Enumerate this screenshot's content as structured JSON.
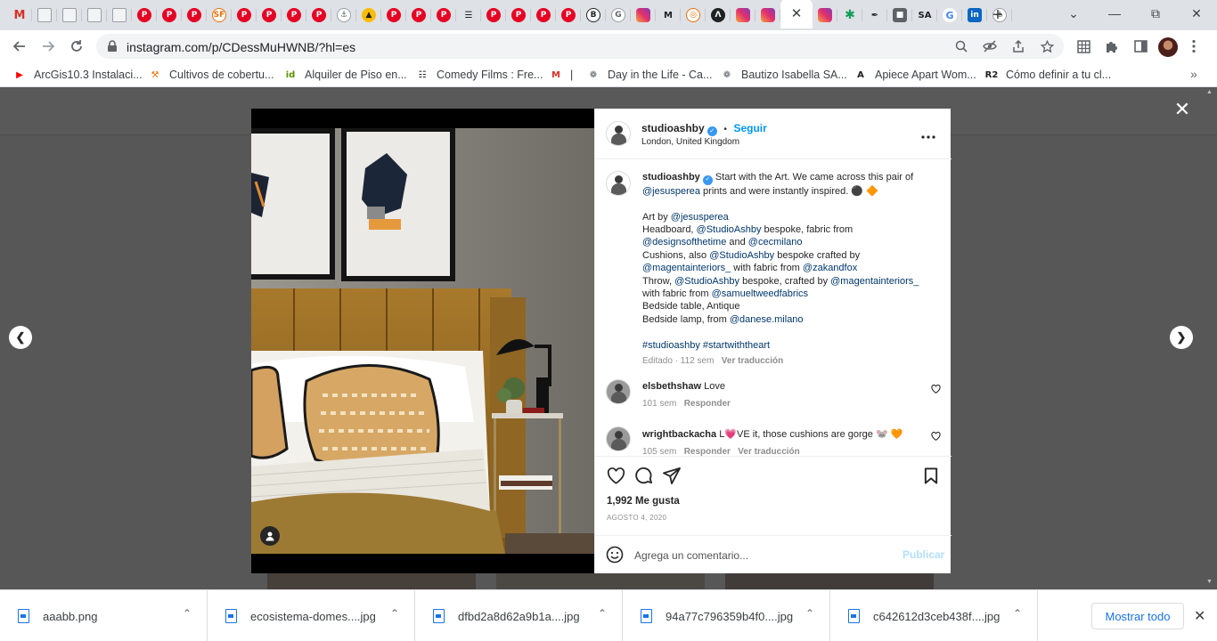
{
  "browser": {
    "tabs": [
      {
        "icon": "gmail-icon",
        "glyph": "M",
        "kind": "gm"
      },
      {
        "icon": "document-icon",
        "glyph": "",
        "kind": "doc"
      },
      {
        "icon": "newspaper-icon",
        "glyph": "",
        "kind": "doc"
      },
      {
        "icon": "newspaper-icon",
        "glyph": "",
        "kind": "doc"
      },
      {
        "icon": "newspaper-icon",
        "glyph": "",
        "kind": "doc"
      },
      {
        "icon": "pinterest-icon",
        "glyph": "P",
        "kind": "p"
      },
      {
        "icon": "pinterest-icon",
        "glyph": "P",
        "kind": "p"
      },
      {
        "icon": "pinterest-icon",
        "glyph": "P",
        "kind": "p"
      },
      {
        "icon": "sf-icon",
        "glyph": "SF",
        "kind": "sf"
      },
      {
        "icon": "pinterest-icon",
        "glyph": "P",
        "kind": "p"
      },
      {
        "icon": "pinterest-icon",
        "glyph": "P",
        "kind": "p"
      },
      {
        "icon": "pinterest-icon",
        "glyph": "P",
        "kind": "p"
      },
      {
        "icon": "pinterest-icon",
        "glyph": "P",
        "kind": "p"
      },
      {
        "icon": "link-icon",
        "glyph": "⚓",
        "kind": "light"
      },
      {
        "icon": "yellow-site-icon",
        "glyph": "▲",
        "kind": "yel"
      },
      {
        "icon": "pinterest-icon",
        "glyph": "P",
        "kind": "p"
      },
      {
        "icon": "pinterest-icon",
        "glyph": "P",
        "kind": "p"
      },
      {
        "icon": "pinterest-icon",
        "glyph": "P",
        "kind": "p"
      },
      {
        "icon": "striped-site-icon",
        "glyph": "☰",
        "kind": "txt"
      },
      {
        "icon": "pinterest-icon",
        "glyph": "P",
        "kind": "p"
      },
      {
        "icon": "pinterest-icon",
        "glyph": "P",
        "kind": "p"
      },
      {
        "icon": "pinterest-icon",
        "glyph": "P",
        "kind": "p"
      },
      {
        "icon": "pinterest-icon",
        "glyph": "P",
        "kind": "p"
      },
      {
        "icon": "b-site-icon",
        "glyph": "B",
        "kind": "ab"
      },
      {
        "icon": "g-site-icon",
        "glyph": "G",
        "kind": "light"
      },
      {
        "icon": "instagram-icon",
        "glyph": "",
        "kind": "ig"
      },
      {
        "icon": "medium-icon",
        "glyph": "M",
        "kind": "txt"
      },
      {
        "icon": "target-icon",
        "glyph": "◎",
        "kind": "sf"
      },
      {
        "icon": "triangle-site-icon",
        "glyph": "Λ",
        "kind": "dark"
      },
      {
        "icon": "instagram-icon",
        "glyph": "",
        "kind": "ig"
      },
      {
        "icon": "instagram-icon",
        "glyph": "",
        "kind": "ig"
      }
    ],
    "active_tab_close": "✕",
    "tabs_after": [
      {
        "icon": "instagram-icon",
        "glyph": "",
        "kind": "ig"
      },
      {
        "icon": "asterisk-site-icon",
        "glyph": "✱",
        "kind": "grn"
      },
      {
        "icon": "tools-site-icon",
        "glyph": "✒",
        "kind": "txt"
      },
      {
        "icon": "cube-site-icon",
        "glyph": "■",
        "kind": "grey"
      },
      {
        "icon": "sa-site-icon",
        "glyph": "SA",
        "kind": "txt"
      },
      {
        "icon": "google-icon",
        "glyph": "G",
        "kind": "goog"
      },
      {
        "icon": "linkedin-icon",
        "glyph": "in",
        "kind": "li"
      },
      {
        "icon": "link-icon",
        "glyph": "⚓",
        "kind": "light"
      }
    ],
    "new_tab": "+",
    "tab_search": "⌄",
    "minimize": "—",
    "maximize": "⧉",
    "close": "✕",
    "url": "instagram.com/p/CDessMuHWNB/?hl=es",
    "bookmarks": [
      {
        "label": "ArcGis10.3 Instalaci...",
        "icon": "youtube-icon",
        "glyph": "▶",
        "color": "#ff0000"
      },
      {
        "label": "Cultivos de cobertu...",
        "icon": "tools-bookmark-icon",
        "glyph": "⚒",
        "color": "#e8710a"
      },
      {
        "label": "Alquiler de Piso en...",
        "icon": "idealista-icon",
        "glyph": "id",
        "color": "#5a8f00"
      },
      {
        "label": "Comedy Films : Fre...",
        "icon": "archive-icon",
        "glyph": "☷",
        "color": "#202124"
      },
      {
        "label": "|",
        "icon": "gmail-icon",
        "glyph": "M",
        "color": "#d93025"
      },
      {
        "label": "Day in the Life - Ca...",
        "icon": "globe-icon",
        "glyph": "❁",
        "color": "#5f6368"
      },
      {
        "label": "Bautizo Isabella SA...",
        "icon": "globe-icon",
        "glyph": "❁",
        "color": "#5f6368"
      },
      {
        "label": "Apiece Apart Wom...",
        "icon": "apiece-icon",
        "glyph": "A",
        "color": "#202124"
      },
      {
        "label": "Cómo definir a tu cl...",
        "icon": "r2-icon",
        "glyph": "R2",
        "color": "#202124"
      }
    ],
    "bookmarks_more": "»"
  },
  "post": {
    "username": "studioashby",
    "follow": "Seguir",
    "separator": "•",
    "location": "London, United Kingdom",
    "more": "•••",
    "caption_lines": [
      {
        "parts": [
          {
            "t": "Start with the Art. We came across this pair of",
            "m": false
          }
        ]
      },
      {
        "parts": [
          {
            "t": "@jesusperea",
            "m": true
          },
          {
            "t": " prints and were instantly inspired. ⚫ 🔶",
            "m": false
          }
        ]
      },
      {
        "parts": [
          {
            "t": " ",
            "m": false
          }
        ]
      },
      {
        "parts": [
          {
            "t": "Art by ",
            "m": false
          },
          {
            "t": "@jesusperea",
            "m": true
          }
        ]
      },
      {
        "parts": [
          {
            "t": "Headboard, ",
            "m": false
          },
          {
            "t": "@StudioAshby",
            "m": true
          },
          {
            "t": " bespoke, fabric from",
            "m": false
          }
        ]
      },
      {
        "parts": [
          {
            "t": "@designsofthetime",
            "m": true
          },
          {
            "t": " and ",
            "m": false
          },
          {
            "t": "@cecmilano",
            "m": true
          }
        ]
      },
      {
        "parts": [
          {
            "t": "Cushions, also ",
            "m": false
          },
          {
            "t": "@StudioAshby",
            "m": true
          },
          {
            "t": " bespoke crafted by",
            "m": false
          }
        ]
      },
      {
        "parts": [
          {
            "t": "@magentainteriors_",
            "m": true
          },
          {
            "t": " with fabric from ",
            "m": false
          },
          {
            "t": "@zakandfox",
            "m": true
          }
        ]
      },
      {
        "parts": [
          {
            "t": "Throw, ",
            "m": false
          },
          {
            "t": "@StudioAshby",
            "m": true
          },
          {
            "t": " bespoke, crafted by ",
            "m": false
          },
          {
            "t": "@magentainteriors_",
            "m": true
          }
        ]
      },
      {
        "parts": [
          {
            "t": "with fabric from ",
            "m": false
          },
          {
            "t": "@samueltweedfabrics",
            "m": true
          }
        ]
      },
      {
        "parts": [
          {
            "t": "Bedside table, Antique",
            "m": false
          }
        ]
      },
      {
        "parts": [
          {
            "t": "Bedside lamp, from ",
            "m": false
          },
          {
            "t": "@danese.milano",
            "m": true
          }
        ]
      },
      {
        "parts": [
          {
            "t": " ",
            "m": false
          }
        ]
      },
      {
        "parts": [
          {
            "t": "#studioashby #startwiththeart",
            "m": true
          }
        ]
      }
    ],
    "caption_meta_edited": "Editado · 112 sem",
    "caption_meta_translate": "Ver traducción",
    "comments": [
      {
        "user": "elsbethshaw",
        "text": "Love",
        "age": "101 sem",
        "reply": "Responder",
        "translate": ""
      },
      {
        "user": "wrightbackacha",
        "text": "L💗VE it, those cushions are gorge 🐭 🧡",
        "age": "105 sem",
        "reply": "Responder",
        "translate": "Ver traducción"
      }
    ],
    "likes": "1,992 Me gusta",
    "date": "AGOSTO 4, 2020",
    "comment_placeholder": "Agrega un comentario...",
    "publish": "Publicar"
  },
  "overlay": {
    "close": "✕",
    "prev": "❮",
    "next": "❯"
  },
  "downloads": {
    "files": [
      "aaabb.png",
      "ecosistema-domes....jpg",
      "dfbd2a8d62a9b1a....jpg",
      "94a77c796359b4f0....jpg",
      "c642612d3ceb438f....jpg"
    ],
    "caret": "⌃",
    "show_all": "Mostrar todo",
    "close": "✕"
  }
}
